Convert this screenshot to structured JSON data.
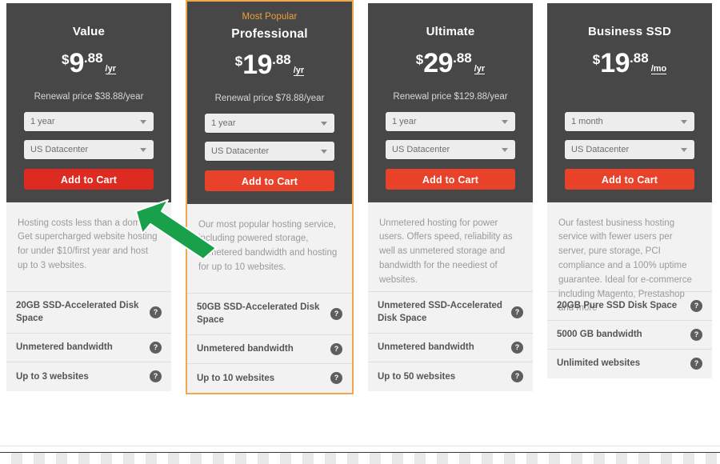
{
  "accent": {
    "featured_border": "#eda94b",
    "popular_tag": "#e8a33d",
    "cart_red_primary": "#dd2b22",
    "cart_red": "#e8432a",
    "card_head_bg": "#474747",
    "card_body_bg": "#f2f2f2",
    "arrow_green": "#18a04b"
  },
  "cursor": {
    "icon": "arrow-cursor-up-left",
    "color": "#18a04b"
  },
  "plans": [
    {
      "badge": "",
      "name": "Value",
      "price": {
        "currency": "$",
        "whole": "9",
        "cents": ".88",
        "period": "/yr"
      },
      "renewal": "Renewal price $38.88/year",
      "term_select": {
        "value": "1 year"
      },
      "datacenter_select": {
        "value": "US Datacenter"
      },
      "cart_label": "Add to Cart",
      "description": "Hosting costs less than a domain! Get supercharged website hosting for under $10/first year and host up to 3 websites.",
      "features": [
        {
          "label": "20GB SSD-Accelerated Disk Space",
          "help": "?"
        },
        {
          "label": "Unmetered bandwidth",
          "help": "?"
        },
        {
          "label": "Up to 3 websites",
          "help": "?"
        }
      ]
    },
    {
      "badge": "Most Popular",
      "name": "Professional",
      "price": {
        "currency": "$",
        "whole": "19",
        "cents": ".88",
        "period": "/yr"
      },
      "renewal": "Renewal price $78.88/year",
      "term_select": {
        "value": "1 year"
      },
      "datacenter_select": {
        "value": "US Datacenter"
      },
      "cart_label": "Add to Cart",
      "description": "Our most popular hosting service, including powered storage, unmetered bandwidth and hosting for up to 10 websites.",
      "features": [
        {
          "label": "50GB SSD-Accelerated Disk Space",
          "help": "?"
        },
        {
          "label": "Unmetered bandwidth",
          "help": "?"
        },
        {
          "label": "Up to 10 websites",
          "help": "?"
        }
      ]
    },
    {
      "badge": "",
      "name": "Ultimate",
      "price": {
        "currency": "$",
        "whole": "29",
        "cents": ".88",
        "period": "/yr"
      },
      "renewal": "Renewal price $129.88/year",
      "term_select": {
        "value": "1 year"
      },
      "datacenter_select": {
        "value": "US Datacenter"
      },
      "cart_label": "Add to Cart",
      "description": "Unmetered hosting for power users. Offers speed, reliability as well as unmetered storage and bandwidth for the neediest of websites.",
      "features": [
        {
          "label": "Unmetered SSD-Accelerated Disk Space",
          "help": "?"
        },
        {
          "label": "Unmetered bandwidth",
          "help": "?"
        },
        {
          "label": "Up to 50 websites",
          "help": "?"
        }
      ]
    },
    {
      "badge": "",
      "name": "Business SSD",
      "price": {
        "currency": "$",
        "whole": "19",
        "cents": ".88",
        "period": "/mo"
      },
      "renewal": "",
      "term_select": {
        "value": "1 month"
      },
      "datacenter_select": {
        "value": "US Datacenter"
      },
      "cart_label": "Add to Cart",
      "description": "Our fastest business hosting service with fewer users per server, pure storage, PCI compliance and a 100% uptime guarantee. Ideal for e-commerce including Magento, Prestashop and more",
      "features": [
        {
          "label": "20GB Pure SSD Disk Space",
          "help": "?"
        },
        {
          "label": "5000 GB bandwidth",
          "help": "?"
        },
        {
          "label": "Unlimited websites",
          "help": "?"
        }
      ]
    }
  ]
}
